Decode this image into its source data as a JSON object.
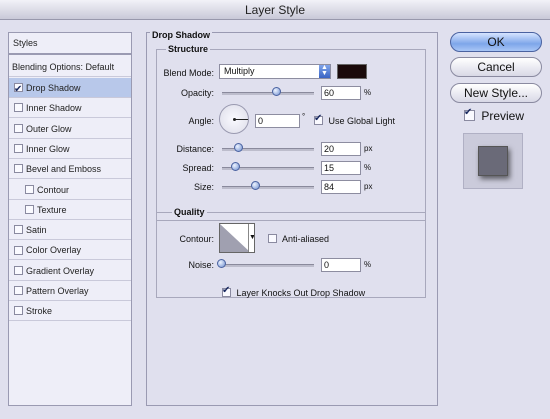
{
  "window": {
    "title": "Layer Style"
  },
  "styles_list": {
    "header": "Styles",
    "blending_options": "Blending Options: Default",
    "items": [
      {
        "label": "Drop Shadow",
        "checked": true,
        "selected": true,
        "indent": false
      },
      {
        "label": "Inner Shadow",
        "checked": false,
        "selected": false,
        "indent": false
      },
      {
        "label": "Outer Glow",
        "checked": false,
        "selected": false,
        "indent": false
      },
      {
        "label": "Inner Glow",
        "checked": false,
        "selected": false,
        "indent": false
      },
      {
        "label": "Bevel and Emboss",
        "checked": false,
        "selected": false,
        "indent": false
      },
      {
        "label": "Contour",
        "checked": false,
        "selected": false,
        "indent": true
      },
      {
        "label": "Texture",
        "checked": false,
        "selected": false,
        "indent": true
      },
      {
        "label": "Satin",
        "checked": false,
        "selected": false,
        "indent": false
      },
      {
        "label": "Color Overlay",
        "checked": false,
        "selected": false,
        "indent": false
      },
      {
        "label": "Gradient Overlay",
        "checked": false,
        "selected": false,
        "indent": false
      },
      {
        "label": "Pattern Overlay",
        "checked": false,
        "selected": false,
        "indent": false
      },
      {
        "label": "Stroke",
        "checked": false,
        "selected": false,
        "indent": false
      }
    ]
  },
  "drop_shadow": {
    "title": "Drop Shadow",
    "structure": {
      "title": "Structure",
      "blend_mode_label": "Blend Mode:",
      "blend_mode_value": "Multiply",
      "shadow_color": "#1a0a0a",
      "opacity_label": "Opacity:",
      "opacity_value": "60",
      "opacity_unit": "%",
      "angle_label": "Angle:",
      "angle_value": "0",
      "angle_unit": "°",
      "use_global_light_label": "Use Global Light",
      "use_global_light_checked": true,
      "distance_label": "Distance:",
      "distance_value": "20",
      "distance_unit": "px",
      "spread_label": "Spread:",
      "spread_value": "15",
      "spread_unit": "%",
      "size_label": "Size:",
      "size_value": "84",
      "size_unit": "px"
    },
    "quality": {
      "title": "Quality",
      "contour_label": "Contour:",
      "anti_aliased_label": "Anti-aliased",
      "anti_aliased_checked": false,
      "noise_label": "Noise:",
      "noise_value": "0",
      "noise_unit": "%"
    },
    "knockout_label": "Layer Knocks Out Drop Shadow",
    "knockout_checked": true
  },
  "buttons": {
    "ok": "OK",
    "cancel": "Cancel",
    "new_style": "New Style...",
    "preview_label": "Preview",
    "preview_checked": true
  },
  "colors": {
    "accent": "#7ea6ea",
    "dialog_bg": "#e0e0ee",
    "selected_row": "#b8c8ea"
  }
}
